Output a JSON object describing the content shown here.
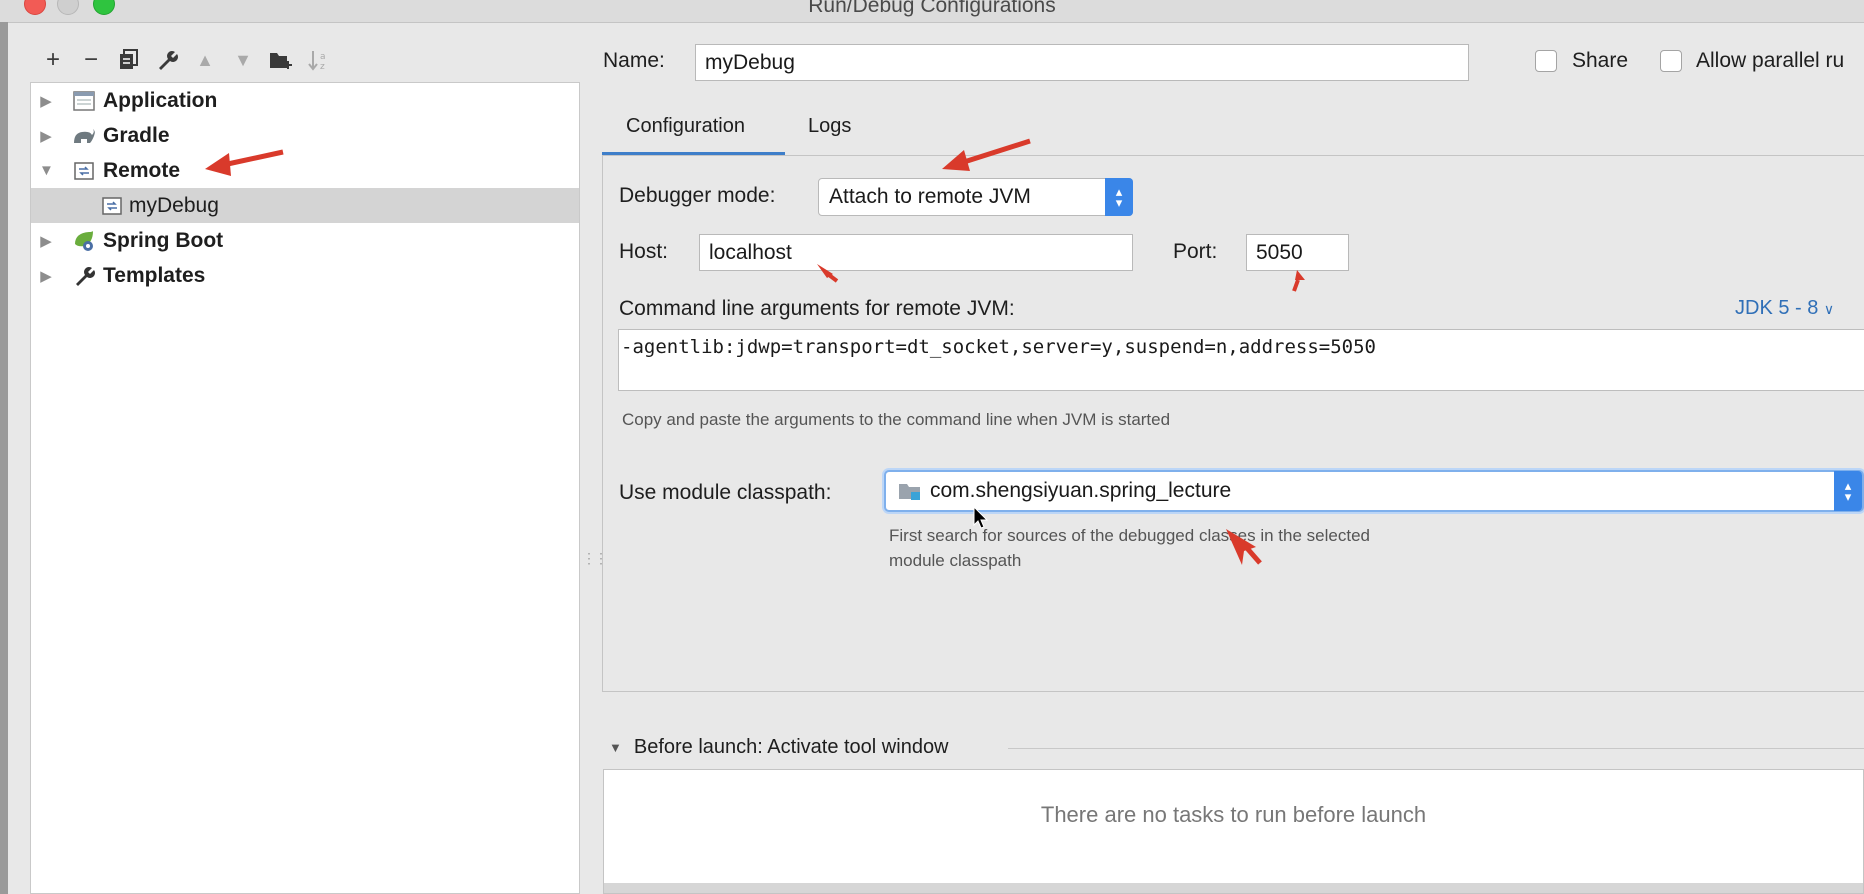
{
  "window": {
    "title": "Run/Debug Configurations"
  },
  "toolbar": {
    "buttons": [
      "add-icon",
      "remove-icon",
      "copy-icon",
      "wrench-icon",
      "move-up-icon",
      "move-down-icon",
      "new-folder-icon",
      "sort-icon"
    ],
    "add_label": "+",
    "remove_label": "−"
  },
  "tree": {
    "items": [
      {
        "label": "Application",
        "icon": "application-icon",
        "expanded": false
      },
      {
        "label": "Gradle",
        "icon": "gradle-icon",
        "expanded": false
      },
      {
        "label": "Remote",
        "icon": "remote-icon",
        "expanded": true
      },
      {
        "label": "myDebug",
        "icon": "remote-config-icon",
        "selected": true
      },
      {
        "label": "Spring Boot",
        "icon": "spring-boot-icon",
        "expanded": false
      },
      {
        "label": "Templates",
        "icon": "wrench-icon",
        "expanded": false
      }
    ]
  },
  "form": {
    "name_label": "Name:",
    "name_value": "myDebug",
    "share_label": "Share",
    "allow_parallel_label": "Allow parallel ru",
    "tabs": [
      {
        "label": "Configuration",
        "active": true
      },
      {
        "label": "Logs",
        "active": false
      }
    ],
    "debugger_mode_label": "Debugger mode:",
    "debugger_mode_value": "Attach to remote JVM",
    "host_label": "Host:",
    "host_value": "localhost",
    "port_label": "Port:",
    "port_value": "5050",
    "cmd_label": "Command line arguments for remote JVM:",
    "jdk_link": "JDK 5 - 8",
    "cmd_value": "-agentlib:jdwp=transport=dt_socket,server=y,suspend=n,address=5050",
    "cmd_hint": "Copy and paste the arguments to the command line when JVM is started",
    "module_label": "Use module classpath:",
    "module_value": "com.shengsiyuan.spring_lecture",
    "module_hint_line1": "First search for sources of the debugged classes in the selected",
    "module_hint_line2": "module classpath"
  },
  "before_launch": {
    "title": "Before launch: Activate tool window",
    "empty_text": "There are no tasks to run before launch"
  },
  "colors": {
    "accent": "#3a86e8",
    "annotation_arrow": "#d93a2b"
  }
}
